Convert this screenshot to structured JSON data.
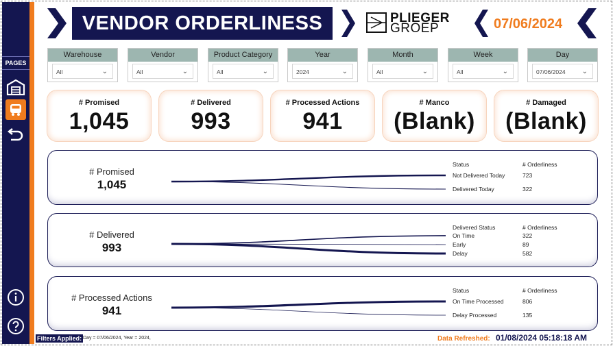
{
  "sidebar": {
    "pages_label": "PAGES",
    "items": [
      {
        "icon": "warehouse-icon"
      },
      {
        "icon": "truck-icon",
        "active": true
      },
      {
        "icon": "back-arrow-icon"
      }
    ],
    "bottom_items": [
      {
        "icon": "info-icon"
      },
      {
        "icon": "help-icon"
      }
    ]
  },
  "header": {
    "title": "VENDOR ORDERLINESS",
    "logo_line1": "PLIEGER",
    "logo_line2": "GROEP",
    "date": "07/06/2024"
  },
  "colors": {
    "navy": "#141650",
    "orange": "#f07c1e",
    "slicer_header": "#9db6b0"
  },
  "slicers": [
    {
      "label": "Warehouse",
      "value": "All"
    },
    {
      "label": "Vendor",
      "value": "All"
    },
    {
      "label": "Product Category",
      "value": "All"
    },
    {
      "label": "Year",
      "value": "2024"
    },
    {
      "label": "Month",
      "value": "All"
    },
    {
      "label": "Week",
      "value": "All"
    },
    {
      "label": "Day",
      "value": "07/06/2024"
    }
  ],
  "kpis": [
    {
      "label": "# Promised",
      "value": "1,045"
    },
    {
      "label": "# Delivered",
      "value": "993"
    },
    {
      "label": "# Processed Actions",
      "value": "941"
    },
    {
      "label": "# Manco",
      "value": "(Blank)"
    },
    {
      "label": "# Damaged",
      "value": "(Blank)"
    }
  ],
  "flows": [
    {
      "label": "# Promised",
      "total": "1,045",
      "col1": "Status",
      "col2": "# Orderliness",
      "rows": [
        {
          "name": "Not Delivered Today",
          "value": "723"
        },
        {
          "name": "Delivered Today",
          "value": "322"
        }
      ]
    },
    {
      "label": "# Delivered",
      "total": "993",
      "col1": "Delivered Status",
      "col2": "# Orderliness",
      "rows": [
        {
          "name": "On Time",
          "value": "322"
        },
        {
          "name": "Early",
          "value": "89"
        },
        {
          "name": "Delay",
          "value": "582"
        }
      ]
    },
    {
      "label": "# Processed Actions",
      "total": "941",
      "col1": "Status",
      "col2": "# Orderliness",
      "rows": [
        {
          "name": "On Time Processed",
          "value": "806"
        },
        {
          "name": "Delay Processed",
          "value": "135"
        }
      ]
    }
  ],
  "footer": {
    "filters_label": "Filters Applied:",
    "filters_text": "Day = 07/06/2024, Year = 2024,",
    "refresh_label": "Data Refreshed:",
    "refresh_value": "01/08/2024 05:18:18 AM"
  }
}
